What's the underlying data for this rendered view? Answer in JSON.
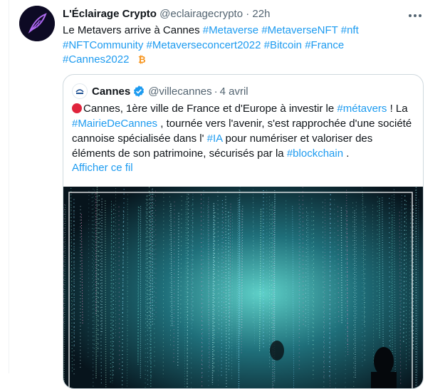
{
  "tweet": {
    "display_name": "L'Éclairage Crypto",
    "handle": "@eclairagecrypto",
    "separator": "·",
    "time": "22h",
    "more_icon": "more-horizontal-icon",
    "text_plain": "Le Metavers arrive à Cannes",
    "hashtags": [
      "#Metaverse",
      "#MetaverseNFT",
      "#nft",
      "#NFTCommunity",
      "#Metaverseconcert2022",
      "#Bitcoin",
      "#France",
      "#Cannes2022"
    ],
    "emoji": "bitcoin-icon"
  },
  "quote": {
    "display_name": "Cannes",
    "handle": "@villecannes",
    "separator": "·",
    "date": "4 avril",
    "part1": "Cannes, 1ère ville de France et d'Europe à investir le ",
    "tag_metavers": "#métavers",
    "part2": " ! La ",
    "tag_mairie": "#MairieDeCannes",
    "part3": " , tournée vers l'avenir, s'est rapprochée d'une société cannoise spécialisée dans l' ",
    "tag_ia": "#IA",
    "part4": " pour numériser et valoriser des éléments de son patrimoine, sécurisés par la ",
    "tag_blockchain": "#blockchain",
    "part5": " .",
    "show_thread": "Afficher ce fil"
  },
  "colors": {
    "accent": "#1d9bf0",
    "muted": "#536471",
    "border": "#cfd9de",
    "bitcoin": "#f7931a",
    "red": "#e0243c"
  }
}
